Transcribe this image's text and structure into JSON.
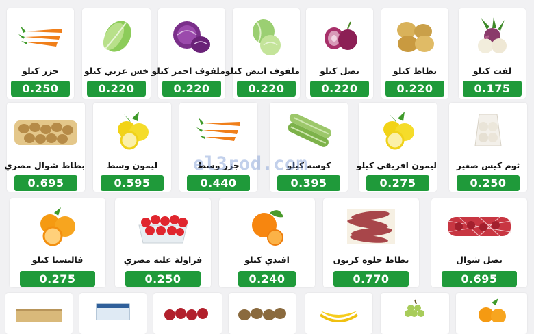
{
  "watermark": "el3rod.com",
  "colors": {
    "price_bg": "#1f9a3a",
    "page_bg": "#f1f1f3"
  },
  "rows": [
    [
      {
        "name": "جزر كيلو",
        "price": "0.250",
        "icon": "carrot-icon"
      },
      {
        "name": "خس عربي كيلو",
        "price": "0.220",
        "icon": "lettuce-icon"
      },
      {
        "name": "ملفوف احمر كيلو",
        "price": "0.220",
        "icon": "red-cabbage-icon"
      },
      {
        "name": "ملفوف ابيض كيلو",
        "price": "0.220",
        "icon": "white-cabbage-icon"
      },
      {
        "name": "بصل كيلو",
        "price": "0.220",
        "icon": "red-onion-icon"
      },
      {
        "name": "بطاط كيلو",
        "price": "0.220",
        "icon": "potato-icon"
      },
      {
        "name": "لفت كيلو",
        "price": "0.175",
        "icon": "turnip-icon"
      }
    ],
    [
      {
        "name": "بطاط شوال مصري",
        "price": "0.695",
        "icon": "potato-sack-icon"
      },
      {
        "name": "ليمون وسط",
        "price": "0.595",
        "icon": "lemon-icon"
      },
      {
        "name": "جزر وسط",
        "price": "0.440",
        "icon": "carrot-icon"
      },
      {
        "name": "كوسه كيلو",
        "price": "0.395",
        "icon": "zucchini-icon"
      },
      {
        "name": "ليمون افريقي كيلو",
        "price": "0.275",
        "icon": "lemon-icon"
      },
      {
        "name": "ثوم كيس صغير",
        "price": "0.250",
        "icon": "garlic-bag-icon"
      }
    ],
    [
      {
        "name": "فالنسيا كيلو",
        "price": "0.275",
        "icon": "orange-icon"
      },
      {
        "name": "فراولة علبه مصري",
        "price": "0.250",
        "icon": "strawberry-box-icon"
      },
      {
        "name": "افندي كيلو",
        "price": "0.240",
        "icon": "tangerine-icon"
      },
      {
        "name": "بطاط حلوه كرتون",
        "price": "0.770",
        "icon": "sweet-potato-icon"
      },
      {
        "name": "بصل شوال",
        "price": "0.695",
        "icon": "onion-sack-icon"
      }
    ],
    [
      {
        "icon": "crate-icon"
      },
      {
        "icon": "box-icon"
      },
      {
        "icon": "apples-icon"
      },
      {
        "icon": "kiwi-icon"
      },
      {
        "icon": "banana-icon"
      },
      {
        "icon": "grapes-icon"
      },
      {
        "icon": "orange-icon"
      }
    ]
  ]
}
